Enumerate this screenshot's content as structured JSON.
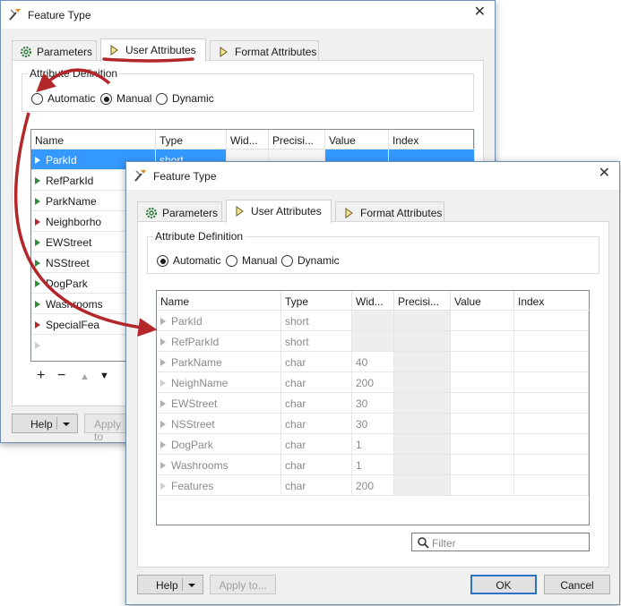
{
  "back_dialog": {
    "title": "Feature Type",
    "close": "✕",
    "tabs": [
      {
        "label": "Parameters",
        "icon": "gear-icon"
      },
      {
        "label": "User Attributes",
        "icon": "attribute-arrow-icon"
      },
      {
        "label": "Format Attributes",
        "icon": "attribute-arrow-icon"
      }
    ],
    "attr_def_legend": "Attribute Definition",
    "radio": {
      "automatic": "Automatic",
      "manual": "Manual",
      "dynamic": "Dynamic",
      "selected": "Manual"
    },
    "columns": [
      "Name",
      "Type",
      "Wid...",
      "Precisi...",
      "Value",
      "Index"
    ],
    "rows": [
      {
        "name": "ParkId",
        "type": "short",
        "marker": "green",
        "selected": true
      },
      {
        "name": "RefParkId",
        "type": "",
        "marker": "green"
      },
      {
        "name": "ParkName",
        "type": "",
        "marker": "green"
      },
      {
        "name": "Neighborho",
        "type": "",
        "marker": "red"
      },
      {
        "name": "EWStreet",
        "type": "",
        "marker": "green"
      },
      {
        "name": "NSStreet",
        "type": "",
        "marker": "green"
      },
      {
        "name": "DogPark",
        "type": "",
        "marker": "green"
      },
      {
        "name": "Washrooms",
        "type": "",
        "marker": "green"
      },
      {
        "name": "SpecialFea",
        "type": "",
        "marker": "red"
      },
      {
        "name": "",
        "type": "",
        "marker": "hollow"
      }
    ],
    "toolbar": {
      "add": "+",
      "remove": "−",
      "up": "▲",
      "down": "▼"
    },
    "help_label": "Help",
    "apply_label": "Apply to"
  },
  "front_dialog": {
    "title": "Feature Type",
    "close": "✕",
    "tabs": [
      {
        "label": "Parameters",
        "icon": "gear-icon"
      },
      {
        "label": "User Attributes",
        "icon": "attribute-arrow-icon"
      },
      {
        "label": "Format Attributes",
        "icon": "attribute-arrow-icon"
      }
    ],
    "attr_def_legend": "Attribute Definition",
    "radio": {
      "automatic": "Automatic",
      "manual": "Manual",
      "dynamic": "Dynamic",
      "selected": "Automatic"
    },
    "columns": [
      "Name",
      "Type",
      "Wid...",
      "Precisi...",
      "Value",
      "Index"
    ],
    "rows": [
      {
        "name": "ParkId",
        "type": "short",
        "width": "",
        "marker": "gray"
      },
      {
        "name": "RefParkId",
        "type": "short",
        "width": "",
        "marker": "gray"
      },
      {
        "name": "ParkName",
        "type": "char",
        "width": "40",
        "marker": "gray"
      },
      {
        "name": "NeighName",
        "type": "char",
        "width": "200",
        "marker": "hollow"
      },
      {
        "name": "EWStreet",
        "type": "char",
        "width": "30",
        "marker": "gray"
      },
      {
        "name": "NSStreet",
        "type": "char",
        "width": "30",
        "marker": "gray"
      },
      {
        "name": "DogPark",
        "type": "char",
        "width": "1",
        "marker": "gray"
      },
      {
        "name": "Washrooms",
        "type": "char",
        "width": "1",
        "marker": "gray"
      },
      {
        "name": "Features",
        "type": "char",
        "width": "200",
        "marker": "hollow"
      }
    ],
    "filter_placeholder": "Filter",
    "help_label": "Help",
    "apply_label": "Apply to...",
    "ok_label": "OK",
    "cancel_label": "Cancel"
  },
  "colors": {
    "annotation_arrow": "#b3262a",
    "selection": "#3399ff",
    "accent_border": "#2c72c7"
  }
}
